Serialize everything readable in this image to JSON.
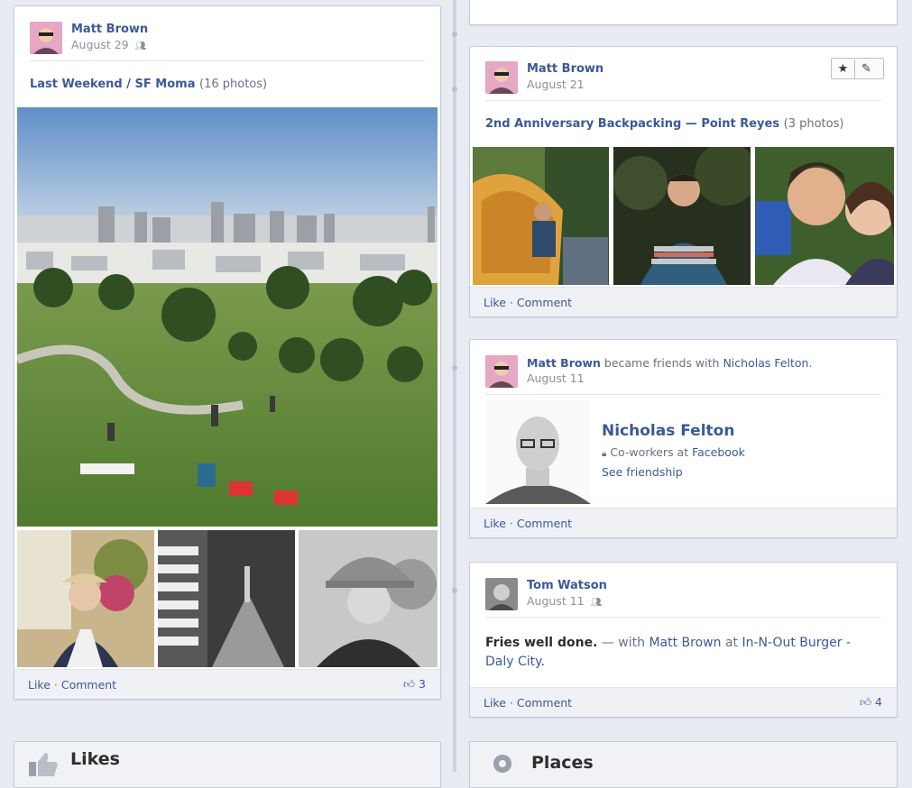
{
  "left_post": {
    "author": "Matt Brown",
    "date": "August 29",
    "audience_icon": "friends-icon",
    "album_title": "Last Weekend / SF Moma",
    "album_count": "(16 photos)",
    "actions": {
      "like": "Like",
      "sep": " · ",
      "comment": "Comment"
    },
    "like_count": "3"
  },
  "right_post_1": {
    "author": "Matt Brown",
    "date": "August 21",
    "album_title": "2nd Anniversary Backpacking — Point Reyes",
    "album_count": "(3 photos)",
    "actions": {
      "like": "Like",
      "sep": " · ",
      "comment": "Comment"
    },
    "star_icon": "star-icon",
    "edit_icon": "pencil-icon"
  },
  "right_post_2": {
    "author": "Matt Brown",
    "verb": "became friends with",
    "friend": "Nicholas Felton",
    "period": ".",
    "date": "August 11",
    "friend_card": {
      "name": "Nicholas Felton",
      "lock_icon": "lock-icon",
      "relation_prefix": "Co-workers at",
      "relation_link": "Facebook",
      "see_friendship": "See friendship"
    },
    "actions": {
      "like": "Like",
      "sep": " · ",
      "comment": "Comment"
    }
  },
  "right_post_3": {
    "author": "Tom Watson",
    "date": "August 11",
    "status": "Fries well done.",
    "with_text": "— with",
    "with_name": "Matt Brown",
    "at_text": "at",
    "place": "In-N-Out Burger - Daly City",
    "period": ".",
    "actions": {
      "like": "Like",
      "sep": " · ",
      "comment": "Comment"
    },
    "like_count": "4"
  },
  "sections": {
    "likes": "Likes",
    "places": "Places"
  },
  "colors": {
    "link": "#3b5998",
    "meta": "#8a8f99",
    "spine": "#cdd3e1"
  }
}
